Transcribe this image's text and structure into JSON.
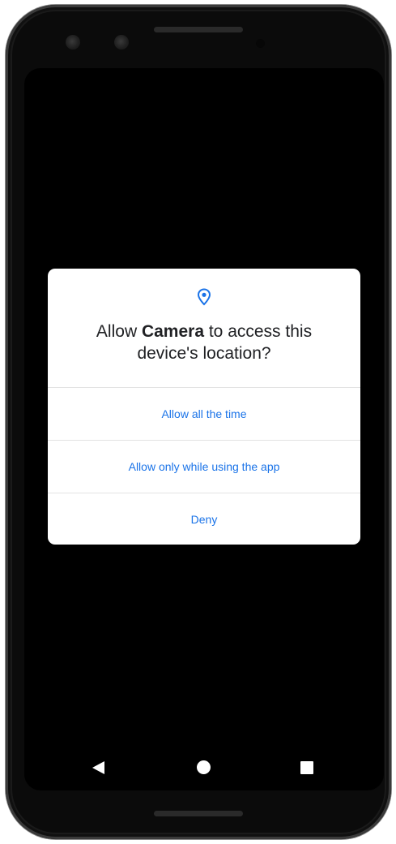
{
  "dialog": {
    "icon": "location-pin-icon",
    "title_prefix": "Allow ",
    "title_app": "Camera",
    "title_suffix": " to access this device's location?",
    "options": [
      {
        "label": "Allow all the time"
      },
      {
        "label": "Allow only while using the app"
      },
      {
        "label": "Deny"
      }
    ]
  },
  "navigation": {
    "back_icon": "back-triangle-icon",
    "home_icon": "home-circle-icon",
    "recents_icon": "recents-square-icon"
  },
  "colors": {
    "accent": "#1a73e8",
    "screen": "#000000",
    "dialog_bg": "#ffffff",
    "title_text": "#202124"
  }
}
